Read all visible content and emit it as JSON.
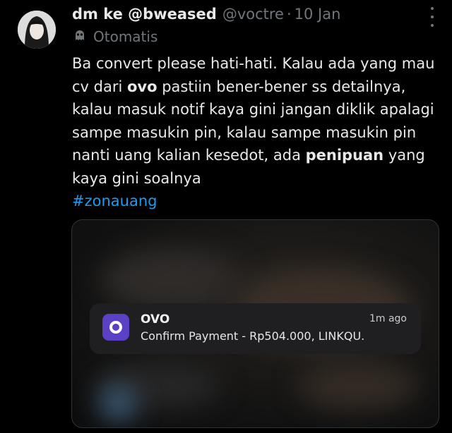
{
  "tweet": {
    "display_name": "dm ke @bweased",
    "handle": "@voctre",
    "separator": "·",
    "date": "10 Jan",
    "automated_label": "Otomatis",
    "text": {
      "part1": "Ba convert please hati-hati. Kalau ada yang mau cv dari ",
      "bold1": "ovo",
      "part2": " pastiin bener-bener ss detailnya, kalau masuk notif kaya gini jangan diklik apalagi sampe masukin pin, kalau sampe masukin pin nanti uang kalian kesedot, ada ",
      "bold2": "penipuan",
      "part3": " yang kaya gini soalnya",
      "hashtag": "#zonauang"
    }
  },
  "notification": {
    "app_name": "OVO",
    "time": "1m ago",
    "body": "Confirm Payment - Rp504.000, LINKQU.",
    "icon_color": "#5b3fc4"
  },
  "colors": {
    "background": "#000000",
    "text": "#e7e9ea",
    "muted": "#71767b",
    "hashtag": "#1d9bf0"
  }
}
